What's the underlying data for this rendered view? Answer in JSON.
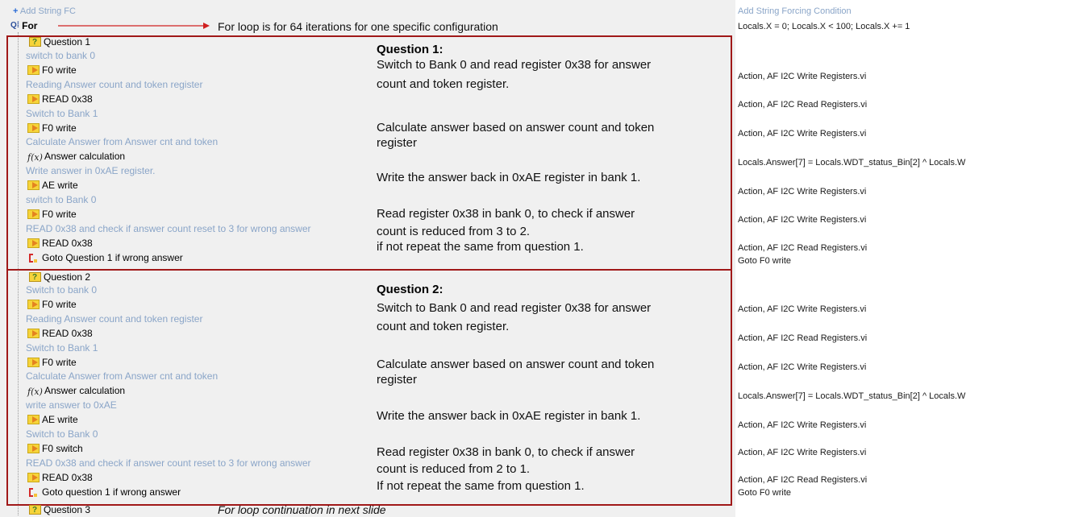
{
  "header": {
    "add_string_fc": "Add String FC",
    "for_label": "For",
    "for_note": "For loop is for 64 iterations for one specific configuration",
    "right_title": "Add String Forcing Condition",
    "right_for": "Locals.X = 0; Locals.X < 100; Locals.X += 1"
  },
  "q1": {
    "title": "Question 1",
    "rows": [
      {
        "type": "comment",
        "text": "switch to bank 0"
      },
      {
        "type": "step",
        "icon": "action-icon",
        "text": "F0 write",
        "right": "Action,  AF I2C Write Registers.vi"
      },
      {
        "type": "comment",
        "text": "Reading Answer count and token register"
      },
      {
        "type": "step",
        "icon": "action-icon",
        "text": "READ 0x38",
        "right": "Action,  AF I2C Read Registers.vi"
      },
      {
        "type": "comment",
        "text": "Switch to Bank 1"
      },
      {
        "type": "step",
        "icon": "action-icon",
        "text": "F0 write",
        "right": "Action,  AF I2C Write Registers.vi"
      },
      {
        "type": "comment",
        "text": "Calculate Answer from Answer cnt and token"
      },
      {
        "type": "step",
        "icon": "fx-icon",
        "text": "Answer calculation",
        "right": "Locals.Answer[7] = Locals.WDT_status_Bin[2] ^ Locals.W"
      },
      {
        "type": "comment",
        "text": "Write answer in 0xAE register."
      },
      {
        "type": "step",
        "icon": "action-icon",
        "text": "AE write",
        "right": "Action,  AF I2C Write Registers.vi"
      },
      {
        "type": "comment",
        "text": "switch to Bank 0"
      },
      {
        "type": "step",
        "icon": "action-icon",
        "text": "F0 write",
        "right": "Action,  AF I2C Write Registers.vi"
      },
      {
        "type": "comment",
        "text": "READ 0x38 and check if answer count reset to 3 for wrong answer"
      },
      {
        "type": "step",
        "icon": "action-icon",
        "text": " READ 0x38",
        "right": "Action,  AF I2C Read Registers.vi"
      },
      {
        "type": "step",
        "icon": "goto-icon",
        "text": "Goto Question 1 if wrong answer",
        "right": "Goto F0 write"
      }
    ],
    "annot_title": "Question 1:",
    "annot": [
      "Switch to Bank 0 and read register 0x38 for answer",
      "count and token register.",
      "Calculate answer based on answer count and token",
      "register",
      "Write the answer back in 0xAE register in bank 1.",
      "Read register 0x38 in bank 0, to check if answer",
      "count is reduced from 3 to 2.",
      "if not repeat the same from question 1."
    ]
  },
  "q2": {
    "title": "Question 2",
    "rows": [
      {
        "type": "comment",
        "text": "Switch to bank 0"
      },
      {
        "type": "step",
        "icon": "action-icon",
        "text": "F0 write",
        "right": "Action,  AF I2C Write Registers.vi"
      },
      {
        "type": "comment",
        "text": "Reading Answer count and token register"
      },
      {
        "type": "step",
        "icon": "action-icon",
        "text": "READ 0x38",
        "right": "Action,  AF I2C Read Registers.vi"
      },
      {
        "type": "comment",
        "text": "Switch to Bank 1"
      },
      {
        "type": "step",
        "icon": "action-icon",
        "text": "F0 write",
        "right": "Action,  AF I2C Write Registers.vi"
      },
      {
        "type": "comment",
        "text": "Calculate Answer from Answer cnt and token"
      },
      {
        "type": "step",
        "icon": "fx-icon",
        "text": "Answer calculation",
        "right": "Locals.Answer[7] = Locals.WDT_status_Bin[2] ^ Locals.W"
      },
      {
        "type": "comment",
        "text": "write answer to 0xAE"
      },
      {
        "type": "step",
        "icon": "action-icon",
        "text": "AE write",
        "right": "Action,  AF I2C Write Registers.vi"
      },
      {
        "type": "comment",
        "text": "Switch to Bank 0"
      },
      {
        "type": "step",
        "icon": "action-icon",
        "text": "F0 switch",
        "right": "Action,  AF I2C Write Registers.vi"
      },
      {
        "type": "comment",
        "text": "READ 0x38 and check if answer count reset to 3 for wrong answer"
      },
      {
        "type": "step",
        "icon": "action-icon",
        "text": "READ 0x38",
        "right": "Action,  AF I2C Read Registers.vi"
      },
      {
        "type": "step",
        "icon": "goto-icon",
        "text": "Goto question 1 if wrong answer",
        "right": "Goto F0 write"
      }
    ],
    "annot_title": "Question 2:",
    "annot": [
      "Switch to Bank 0 and read register 0x38 for answer",
      "count and token register.",
      "Calculate answer based on answer count and token",
      "register",
      "Write the answer back in 0xAE register in bank 1.",
      "Read register 0x38 in bank 0, to check if answer",
      "count is reduced from 2 to 1.",
      "If not repeat the same from question 1."
    ]
  },
  "q3": {
    "title": "Question 3"
  },
  "footer_note": "For loop continuation in next slide"
}
